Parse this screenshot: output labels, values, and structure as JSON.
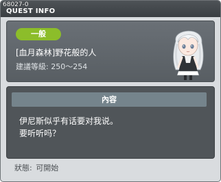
{
  "window": {
    "quest_id": "68027-0",
    "title": "QUEST INFO"
  },
  "quest": {
    "category_badge": "一般",
    "name": "[血月森林]野花般的人",
    "level_label": "建議等級:",
    "level_range": "250～254"
  },
  "content": {
    "header": "內容",
    "lines": [
      "伊尼斯似乎有话要对我说。",
      "要听听吗？"
    ]
  },
  "status": {
    "label": "狀態:",
    "value": "可開始"
  },
  "colors": {
    "badge": "#8cbd2a",
    "titlebar": "#3a3e42",
    "panel": "#585e63",
    "content_bg": "#505559",
    "content_header": "#75848c"
  },
  "icons": {
    "portrait": "npc-portrait-white-haired-girl"
  }
}
